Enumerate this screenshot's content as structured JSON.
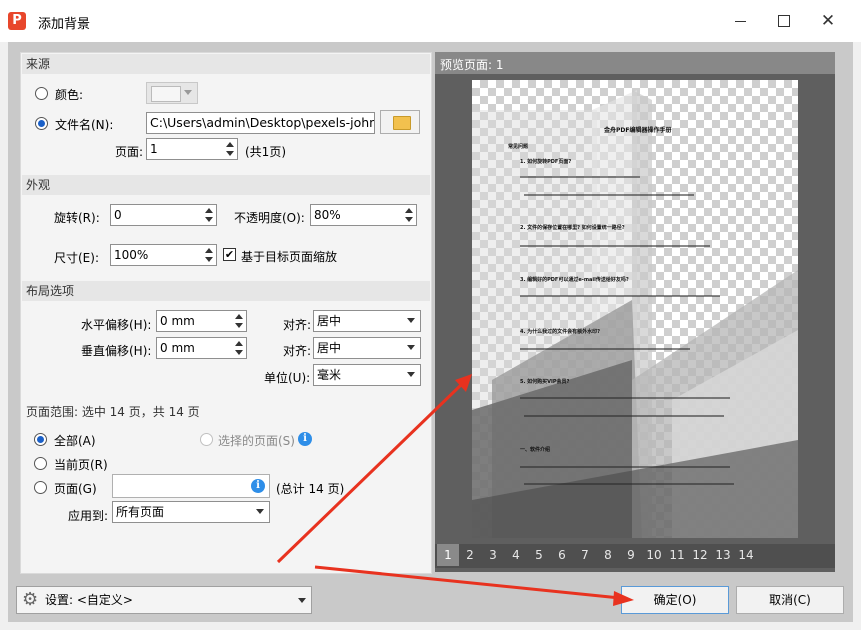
{
  "window": {
    "title": "添加背景",
    "app_icon_letter": "P"
  },
  "source": {
    "section": "来源",
    "color_label": "颜色:",
    "file_label": "文件名(N):",
    "file_value": "C:\\Users\\admin\\Desktop\\pexels-john-l",
    "page_label": "页面:",
    "page_value": "1",
    "page_total": "(共1页)"
  },
  "appearance": {
    "section": "外观",
    "rotate_label": "旋转(R):",
    "rotate_value": "0",
    "opacity_label": "不透明度(O):",
    "opacity_value": "80%",
    "size_label": "尺寸(E):",
    "size_value": "100%",
    "scale_label": "基于目标页面缩放",
    "scale_checked": true
  },
  "layout": {
    "section": "布局选项",
    "hoffset_label": "水平偏移(H):",
    "hoffset_value": "0 mm",
    "halign_label": "对齐:",
    "halign_value": "居中",
    "voffset_label": "垂直偏移(H):",
    "voffset_value": "0 mm",
    "valign_label": "对齐:",
    "valign_value": "居中",
    "unit_label": "单位(U):",
    "unit_value": "毫米"
  },
  "page_range": {
    "title": "页面范围: 选中 14 页，共 14 页",
    "all_label": "全部(A)",
    "selected_label": "选择的页面(S)",
    "current_label": "当前页(R)",
    "pages_label": "页面(G)",
    "pages_total": "(总计 14 页)",
    "apply_label": "应用到:",
    "apply_value": "所有页面"
  },
  "preview": {
    "label": "预览页面: 1",
    "pages": [
      "1",
      "2",
      "3",
      "4",
      "5",
      "6",
      "7",
      "8",
      "9",
      "10",
      "11",
      "12",
      "13",
      "14"
    ],
    "active_page": "1",
    "doc_title": "金舟PDF编辑器操作手册",
    "doc_lines": [
      "常见问题",
      "1. 如何旋转PDF页面?",
      "2. 文件的保存位置在哪里? 如何设置统一路径?",
      "3. 编辑好的PDF可以通过e-mail传送给好友吗?",
      "4. 为什么我过的文件会有额外水印?",
      "5. 如何购买VIP会员?",
      "一、软件介绍"
    ]
  },
  "footer": {
    "settings_label": "设置: <自定义>",
    "ok_label": "确定(O)",
    "cancel_label": "取消(C)"
  },
  "colors": {
    "accent": "#1a60c8",
    "arrow": "#e8321f",
    "preview_bg": "#5f5f5f"
  }
}
